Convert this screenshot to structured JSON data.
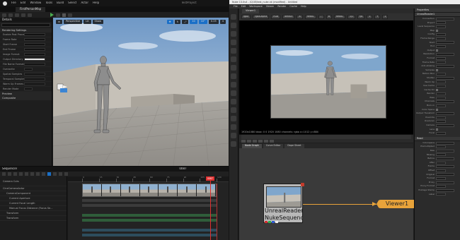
{
  "unreal": {
    "menu": [
      "File",
      "Edit",
      "Window",
      "Tools",
      "Build",
      "Select",
      "Actor",
      "Help"
    ],
    "project_name": "TestProject",
    "level_tab": "FirstPersonMap",
    "details": {
      "title": "Details",
      "section_title": "Rendering Settings",
      "rows": [
        {
          "label": "Enable Post Process",
          "value": ""
        },
        {
          "label": "Frame Rate",
          "value": ""
        },
        {
          "label": "Start Frame",
          "value": ""
        },
        {
          "label": "End Frame",
          "value": ""
        },
        {
          "label": "Image Format",
          "value": ""
        },
        {
          "label": "Output Directory",
          "value": ""
        },
        {
          "label": "File Name Format",
          "value": ""
        },
        {
          "label": "Overwrite",
          "value": ""
        },
        {
          "label": "Spatial Samples",
          "value": ""
        },
        {
          "label": "Temporal Samples",
          "value": ""
        },
        {
          "label": "Warm Up Frames",
          "value": ""
        },
        {
          "label": "Render Mode",
          "value": ""
        }
      ],
      "collapsed": [
        "Preview",
        "Composite"
      ]
    },
    "viewport": {
      "buttons": [
        "Perspective",
        "Lit",
        "Show"
      ],
      "right_buttons": [
        "10",
        "10°",
        "0.25",
        "4"
      ]
    },
    "sequencer": {
      "title": "Sequencer",
      "timecode": "0087",
      "tracks": [
        "Camera Cuts",
        "CineCameraActor",
        "CameraComponent",
        "Current Aperture",
        "Current Focal Length",
        "Manual Focus Distance (Focus Se...",
        "Transform",
        "Transform"
      ],
      "ticks": [
        "0",
        "15",
        "30",
        "45",
        "60",
        "75",
        "90",
        "105",
        "120"
      ]
    }
  },
  "nuke": {
    "title": "Nuke 13.0v4 - /C/UE/test_nuke.nk (modified) - Untitled",
    "menu": [
      "File",
      "Edit",
      "Workspace",
      "Viewer",
      "Render",
      "Cache",
      "Help"
    ],
    "viewer_tab": "Viewer1",
    "viewer_controls": [
      "rgba",
      "rgba.alpha",
      "RGB",
      "default",
      "A",
      "Read1",
      "-",
      "B",
      "Read1",
      "1/1",
      "f/8",
      "1",
      "Y",
      "1"
    ],
    "frame_status": "1920x1080 bbox: 0 0 1920 1080 channels: rgba   x=1012 y=884",
    "graph_tabs": [
      "Node Graph",
      "Curve Editor",
      "Dope Sheet"
    ],
    "read_node": {
      "line1": "UnrealReader1",
      "line2": "NukeSequence"
    },
    "viewer_node": "Viewer1",
    "properties": {
      "header": "Properties",
      "node_header": "UnrealReader1",
      "rows": [
        "Connection",
        "Project",
        "Level Sequence",
        "Map",
        "Config",
        "Frame Range",
        "Start",
        "End",
        "Output",
        "Resolution",
        "Format",
        "Frame Rate",
        "Anti-aliasing",
        "Samples",
        "Motion Blur",
        "Shutter",
        "Warm Up",
        "Use Cache",
        "Cache Dir",
        "Render",
        "Pass",
        "Channels",
        "Burn-in",
        "Color Space",
        "Output Transform",
        "Override",
        "Overscan",
        "Camera",
        "Lens",
        "Focal"
      ],
      "rows2": [
        "Read",
        "Colorspace",
        "Premultiplied",
        "Raw",
        "Missing",
        "Before",
        "After",
        "Frame",
        "Offset",
        "Original",
        "Format",
        "Proxy",
        "Proxy Format",
        "Postage Stamp",
        "Label"
      ]
    }
  }
}
